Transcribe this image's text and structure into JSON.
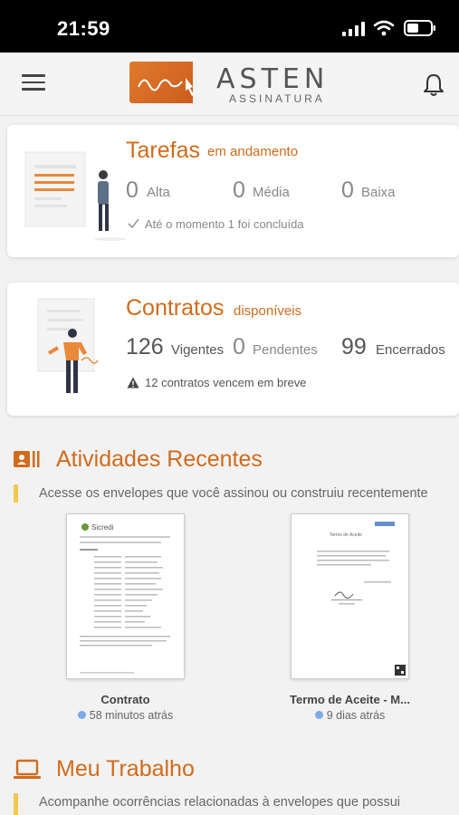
{
  "status_bar": {
    "time": "21:59"
  },
  "header": {
    "logo_brand": "ASTEN",
    "logo_sub": "ASSINATURA"
  },
  "tasks_card": {
    "title": "Tarefas",
    "subtitle": "em andamento",
    "stats": [
      {
        "value": "0",
        "label": "Alta"
      },
      {
        "value": "0",
        "label": "Média"
      },
      {
        "value": "0",
        "label": "Baixa"
      }
    ],
    "note": "Até o momento 1 foi concluída"
  },
  "contracts_card": {
    "title": "Contratos",
    "subtitle": "disponíveis",
    "stats": [
      {
        "value": "126",
        "label": "Vigentes"
      },
      {
        "value": "0",
        "label": "Pendentes"
      },
      {
        "value": "99",
        "label": "Encerrados"
      }
    ],
    "note": "12 contratos vencem em breve"
  },
  "recent": {
    "title": "Atividades Recentes",
    "description": "Acesse os envelopes que você assinou ou construiu recentemente",
    "items": [
      {
        "name": "Contrato",
        "time": "58 minutos atrás",
        "doc_header": "Sicredi"
      },
      {
        "name": "Termo de Aceite - M...",
        "time": "9 dias atrás",
        "doc_header": "Termo de Aceite"
      }
    ]
  },
  "work": {
    "title": "Meu Trabalho",
    "description": "Acompanhe ocorrências relacionadas à envelopes que possui"
  },
  "colors": {
    "accent": "#d16b1c",
    "bar": "#f2c94c",
    "dot": "#7da9e8"
  }
}
